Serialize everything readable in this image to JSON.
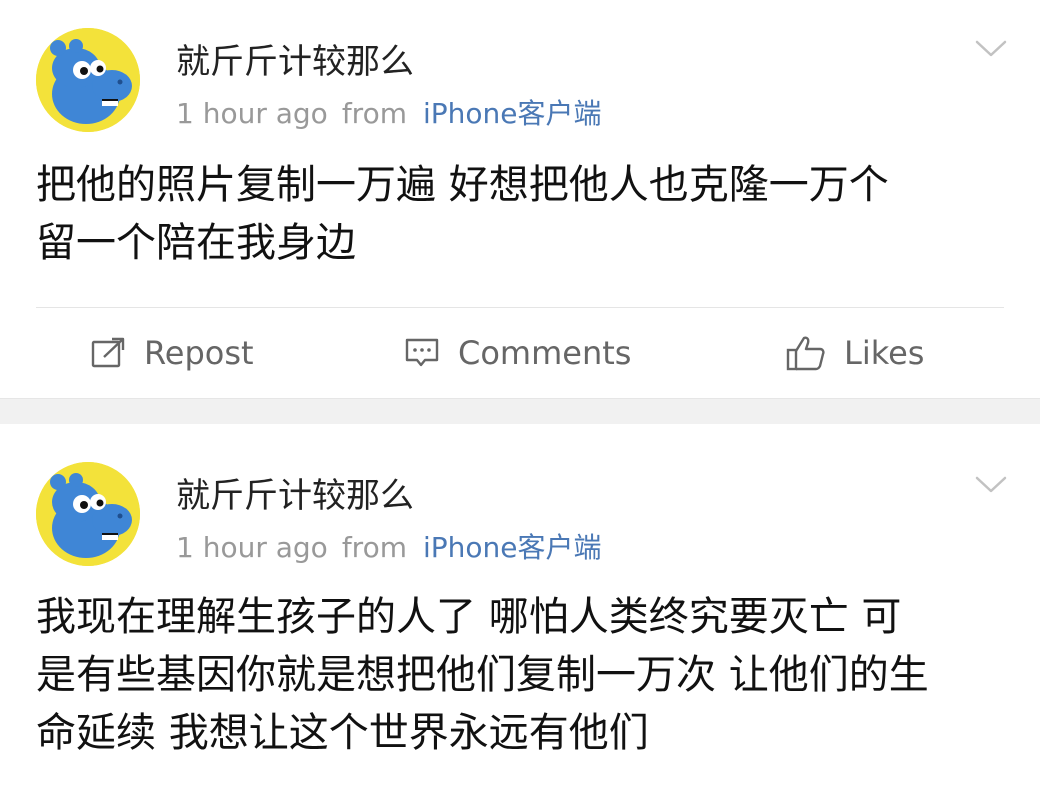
{
  "posts": [
    {
      "username": "就斤斤计较那么",
      "time": "1 hour ago",
      "from_label": "from",
      "source": "iPhone客户端",
      "text_lines": [
        "把他的照片复制一万遍 好想把他人也克隆一万个",
        "留一个陪在我身边"
      ],
      "actions": {
        "repost": "Repost",
        "comments": "Comments",
        "likes": "Likes"
      }
    },
    {
      "username": "就斤斤计较那么",
      "time": "1 hour ago",
      "from_label": "from",
      "source": "iPhone客户端",
      "text_lines": [
        "我现在理解生孩子的人了 哪怕人类终究要灭亡 可",
        "是有些基因你就是想把他们复制一万次 让他们的生",
        "命延续 我想让这个世界永远有他们"
      ]
    }
  ],
  "colors": {
    "source_link": "#4a78b5",
    "meta_gray": "#999999",
    "avatar_bg": "#f3e23a",
    "hippo_blue": "#3f86d6",
    "separator": "#f1f1f1"
  },
  "icons": {
    "avatar": "blue-hippo-avatar",
    "menu": "chevron-down-icon",
    "repost": "repost-icon",
    "comments": "comment-icon",
    "likes": "thumbs-up-icon"
  }
}
